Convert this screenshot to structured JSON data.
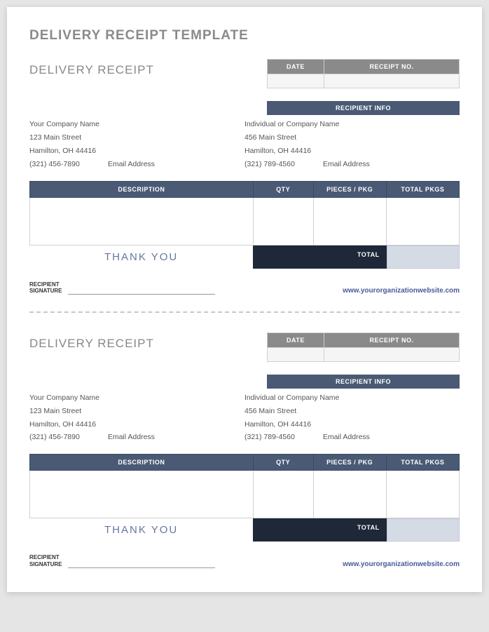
{
  "mainTitle": "DELIVERY RECEIPT TEMPLATE",
  "receipts": [
    {
      "title": "DELIVERY RECEIPT",
      "dateHeader": "DATE",
      "receiptNoHeader": "RECEIPT NO.",
      "recipientInfoHeader": "RECIPIENT INFO",
      "sender": {
        "name": "Your Company Name",
        "street": "123 Main Street",
        "cityline": "Hamilton, OH  44416",
        "phone": "(321) 456-7890",
        "email": "Email Address"
      },
      "recipient": {
        "name": "Individual or Company Name",
        "street": "456 Main Street",
        "cityline": "Hamilton, OH  44416",
        "phone": "(321) 789-4560",
        "email": "Email Address"
      },
      "cols": {
        "description": "DESCRIPTION",
        "qty": "QTY",
        "pieces": "PIECES / PKG",
        "total": "TOTAL PKGS"
      },
      "thankYou": "THANK YOU",
      "totalLabel": "TOTAL",
      "signatureLabel": "RECIPIENT\nSIGNATURE",
      "website": "www.yourorganizationwebsite.com"
    },
    {
      "title": "DELIVERY RECEIPT",
      "dateHeader": "DATE",
      "receiptNoHeader": "RECEIPT NO.",
      "recipientInfoHeader": "RECIPIENT INFO",
      "sender": {
        "name": "Your Company Name",
        "street": "123 Main Street",
        "cityline": "Hamilton, OH  44416",
        "phone": "(321) 456-7890",
        "email": "Email Address"
      },
      "recipient": {
        "name": "Individual or Company Name",
        "street": "456 Main Street",
        "cityline": "Hamilton, OH  44416",
        "phone": "(321) 789-4560",
        "email": "Email Address"
      },
      "cols": {
        "description": "DESCRIPTION",
        "qty": "QTY",
        "pieces": "PIECES / PKG",
        "total": "TOTAL PKGS"
      },
      "thankYou": "THANK YOU",
      "totalLabel": "TOTAL",
      "signatureLabel": "RECIPIENT\nSIGNATURE",
      "website": "www.yourorganizationwebsite.com"
    }
  ]
}
